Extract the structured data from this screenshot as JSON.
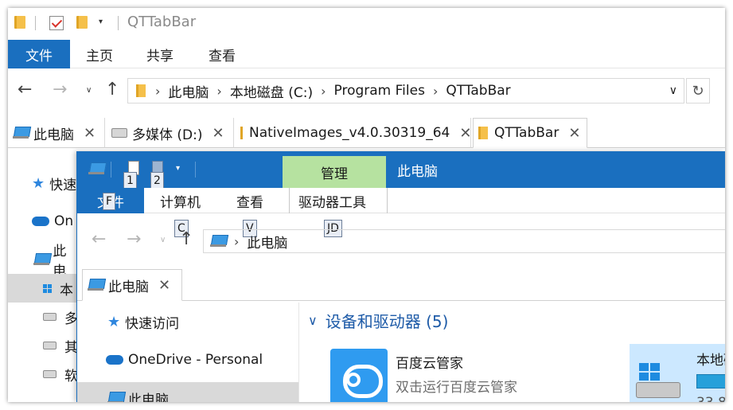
{
  "back_window": {
    "title": "QTTabBar",
    "ribbon_tabs": {
      "file": "文件",
      "home": "主页",
      "share": "共享",
      "view": "查看"
    },
    "address": {
      "crumbs": [
        "此电脑",
        "本地磁盘 (C:)",
        "Program Files",
        "QTTabBar"
      ]
    },
    "tabs": [
      {
        "label": "此电脑",
        "icon": "computer-icon"
      },
      {
        "label": "多媒体 (D:)",
        "icon": "drive-icon"
      },
      {
        "label": "NativeImages_v4.0.30319_64",
        "icon": "folder-icon"
      },
      {
        "label": "QTTabBar",
        "icon": "folder-icon",
        "active": true
      }
    ],
    "nav": [
      "快速",
      "On",
      "此电",
      "本",
      "多",
      "其",
      "软"
    ]
  },
  "front_window": {
    "manage_tab": "管理",
    "title": "此电脑",
    "qat_badges": [
      "1",
      "2"
    ],
    "ribbon_tabs": {
      "file": "文件",
      "computer": "计算机",
      "view": "查看",
      "drive_tools": "驱动器工具"
    },
    "key_tips": {
      "file": "F",
      "computer": "C",
      "view": "V",
      "drive_tools": "JD"
    },
    "address": {
      "crumb": "此电脑"
    },
    "tab": {
      "label": "此电脑"
    },
    "nav": [
      "快速访问",
      "OneDrive - Personal",
      "此电脑"
    ],
    "group_header": "设备和驱动器 (5)",
    "items": [
      {
        "name": "百度云管家",
        "desc": "双击运行百度云管家",
        "icon": "baidu-cloud-icon"
      },
      {
        "name": "本地磁",
        "size_text": "33.8",
        "icon": "local-disk-icon"
      }
    ]
  },
  "colors": {
    "accent": "#1a6fbf",
    "manage": "#b6e2a0",
    "selection": "#cce8ff"
  }
}
